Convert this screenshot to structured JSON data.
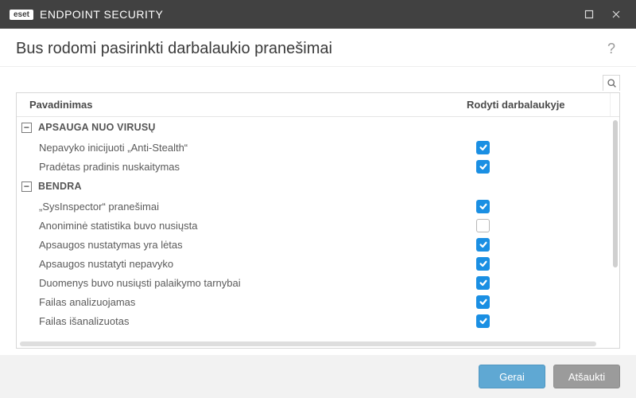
{
  "titlebar": {
    "logo": "eset",
    "product": "ENDPOINT SECURITY"
  },
  "heading": "Bus rodomi pasirinkti darbalaukio pranešimai",
  "columns": {
    "name": "Pavadinimas",
    "show": "Rodyti darbalaukyje"
  },
  "groups": [
    {
      "title": "APSAUGA NUO VIRUSŲ",
      "items": [
        {
          "label": "Nepavyko inicijuoti „Anti-Stealth“",
          "checked": true
        },
        {
          "label": "Pradėtas pradinis nuskaitymas",
          "checked": true
        }
      ]
    },
    {
      "title": "BENDRA",
      "items": [
        {
          "label": "„SysInspector“ pranešimai",
          "checked": true
        },
        {
          "label": "Anoniminė statistika buvo nusiųsta",
          "checked": false
        },
        {
          "label": "Apsaugos nustatymas yra lėtas",
          "checked": true
        },
        {
          "label": "Apsaugos nustatyti nepavyko",
          "checked": true
        },
        {
          "label": "Duomenys buvo nusiųsti palaikymo tarnybai",
          "checked": true
        },
        {
          "label": "Failas analizuojamas",
          "checked": true
        },
        {
          "label": "Failas išanalizuotas",
          "checked": true
        }
      ]
    }
  ],
  "footer": {
    "ok": "Gerai",
    "cancel": "Atšaukti"
  }
}
